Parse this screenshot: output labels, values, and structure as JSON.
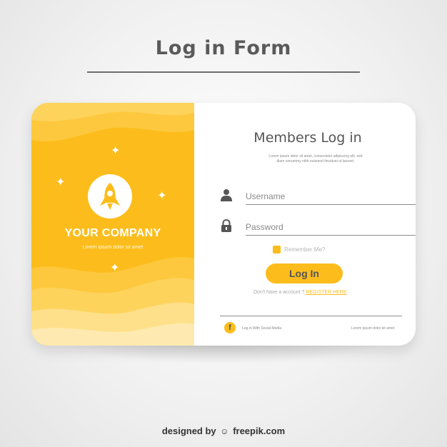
{
  "page": {
    "title": "Log in Form",
    "credit_prefix": "designed by",
    "credit_brand": "freepik.com",
    "credit_icon": "freepik-logo-icon"
  },
  "brand": {
    "company_name": "YOUR COMPANY",
    "tagline": "Lorem ipsum dolor sit amet",
    "logo_icon": "rocket-icon",
    "sparkle_icon": "sparkle-icon"
  },
  "form": {
    "heading": "Members Log in",
    "description_line1": "Lorem ipsum dolor sit amet, consectetur adipiscing elit, sed",
    "description_line2": "diam nonummy nibh euismod tincidunt ut laoreet.",
    "username": {
      "icon": "user-icon",
      "placeholder": "Username",
      "value": ""
    },
    "password": {
      "icon": "lock-icon",
      "placeholder": "Password",
      "value": ""
    },
    "remember_label": "Remember Me?",
    "remember_checked": false,
    "submit_label": "Log In",
    "register_prompt": "Don't have a account ?",
    "register_link": "REGISTER HERE"
  },
  "footer": {
    "social_icon": "facebook-icon",
    "social_glyph": "f",
    "social_label": "Log in With Social Media",
    "note": "Lorem ipsum dolor sit amet"
  },
  "colors": {
    "accent": "#fcbd1c",
    "text_dark": "#555555",
    "text_muted": "#8a8a8a",
    "card": "#ffffff"
  }
}
